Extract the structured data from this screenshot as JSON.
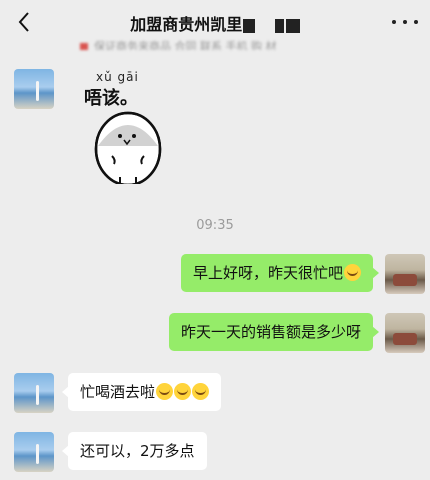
{
  "header": {
    "title": "加盟商贵州凯里"
  },
  "pinned_notice": "保证商务来商品 合同 联系 手机 购 材",
  "sticker": {
    "pinyin": "xǔ gāi",
    "text": "唔该。"
  },
  "timestamp": "09:35",
  "messages": [
    {
      "side": "me",
      "text": "早上好呀，昨天很忙吧"
    },
    {
      "side": "me",
      "text": "昨天一天的销售额是多少呀"
    },
    {
      "side": "them",
      "text": "忙喝酒去啦"
    },
    {
      "side": "them",
      "text": "还可以，2万多点"
    }
  ],
  "emoji": {
    "thinking": "thinking-face-emoji",
    "laughing": "tears-of-joy-emoji"
  }
}
